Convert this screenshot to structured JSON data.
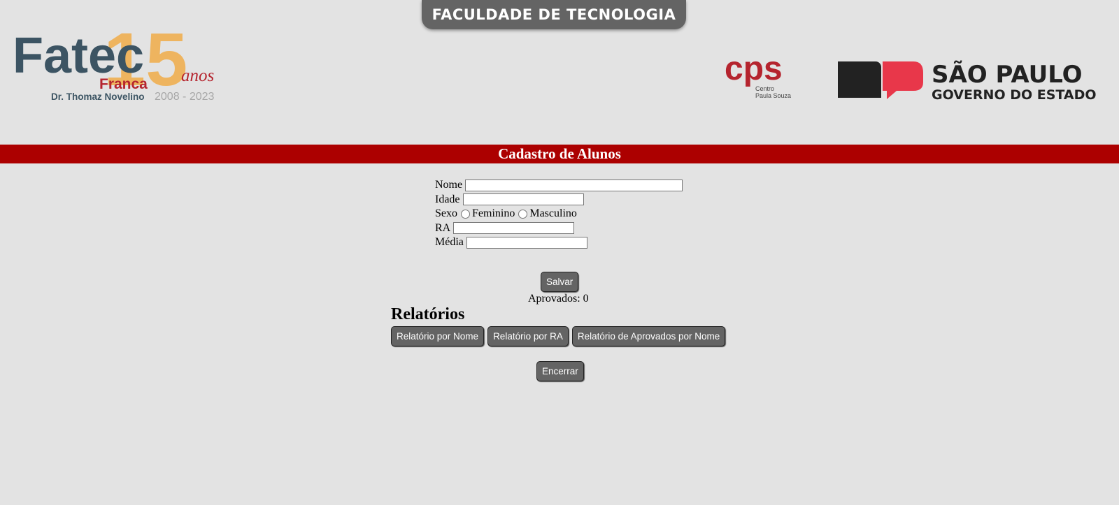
{
  "header": {
    "institution_banner": "FACULDADE DE TECNOLOGIA",
    "fatec_logo": {
      "name": "Fatec",
      "number": "15",
      "anos": "anos",
      "city": "Franca",
      "patron": "Dr. Thomaz Novelino",
      "years": "2008 - 2023"
    },
    "cps_logo": {
      "mark": "cps",
      "line1": "Centro",
      "line2": "Paula Souza"
    },
    "sp_logo": {
      "line1": "SÃO PAULO",
      "line2": "GOVERNO DO ESTADO"
    }
  },
  "page_title": "Cadastro de Alunos",
  "form": {
    "nome_label": "Nome",
    "nome_value": "",
    "idade_label": "Idade",
    "idade_value": "",
    "sexo_label": "Sexo",
    "sexo_options": [
      "Feminino",
      "Masculino"
    ],
    "ra_label": "RA",
    "ra_value": "",
    "media_label": "Média",
    "media_value": ""
  },
  "salvar_label": "Salvar",
  "approved_text": "Aprovados: 0",
  "reports": {
    "title": "Relatórios",
    "by_name": "Relatório por Nome",
    "by_ra": "Relatório por RA",
    "approved_by_name": "Relatório de Aprovados por Nome"
  },
  "encerrar_label": "Encerrar",
  "colors": {
    "background": "#e3e3e3",
    "title_bar": "#ac0000",
    "button": "#646464",
    "fatec_dark": "#3c5463",
    "fatec_orange": "#eeb45f",
    "franca_red": "#b5242e",
    "sp_red": "#e8374a"
  }
}
